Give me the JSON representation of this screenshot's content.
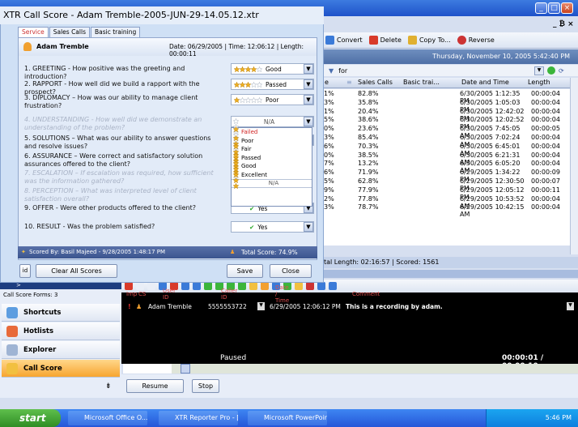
{
  "dialog": {
    "title": "XTR Call Score - Adam Tremble-2005-JUN-29-14.05.12.xtr",
    "tabs": [
      "Service",
      "Sales Calls",
      "Basic training"
    ],
    "agent_name": "Adam Tremble",
    "call_info": "Date: 06/29/2005 | Time: 12:06:12 | Length: 00:00:11",
    "questions": [
      {
        "text": "1. GREETING - How positive was the greeting and introduction?",
        "value": "Good",
        "stars": 4,
        "dim": false
      },
      {
        "text": "2. RAPPORT - How well did we build a rapport with the prospect?",
        "value": "Passed",
        "stars": 3,
        "dim": false
      },
      {
        "text": "3.  DIPLOMACY – How was our ability to manage client frustration?",
        "value": "Poor",
        "stars": 1,
        "dim": false
      },
      {
        "text": "4. UNDERSTANDING - How well did we demonstrate an understanding of the problem?",
        "value": "N/A",
        "stars": 0,
        "dim": true
      },
      {
        "text": "5. SOLUTIONS – What was our ability to answer questions and resolve issues?",
        "value": "",
        "stars": 0,
        "dim": false
      },
      {
        "text": "6. ASSURANCE – Were correct and satisfactory solution assurances offered to the client?",
        "value": "",
        "stars": 0,
        "dim": false
      },
      {
        "text": "7. ESCALATION – If escalation was required, how sufficient was the information gathered?",
        "value": "",
        "stars": 0,
        "dim": true
      },
      {
        "text": "8. PERCEPTION – What was interpreted level of client satisfaction overall?",
        "value": "",
        "stars": 0,
        "dim": true
      },
      {
        "text": "9. OFFER - Were other products offered to the client?",
        "value": "Yes",
        "stars": 0,
        "dim": false
      },
      {
        "text": "10. RESULT - Was the problem satisfied?",
        "value": "Yes",
        "stars": 0,
        "dim": false
      }
    ],
    "dropdown_options": [
      {
        "label": "Failed",
        "stars": 0,
        "color": "#d02020"
      },
      {
        "label": "Poor",
        "stars": 1,
        "color": "#000000"
      },
      {
        "label": "Fair",
        "stars": 2,
        "color": "#000000"
      },
      {
        "label": "Passed",
        "stars": 3,
        "color": "#000000"
      },
      {
        "label": "Good",
        "stars": 4,
        "color": "#000000"
      },
      {
        "label": "Excellent",
        "stars": 5,
        "color": "#000000"
      },
      {
        "label": "N/A",
        "stars": 0,
        "color": "#555555"
      }
    ],
    "scored_by": "Scored By: Basil Majeed - 9/28/2005 1:48:17 PM",
    "total_score": "Total Score: 74.9%",
    "clear_button": "Clear All Scores",
    "save_button": "Save",
    "close_button": "Close"
  },
  "main": {
    "toolbar": {
      "convert": "Convert",
      "delete": "Delete",
      "copy": "Copy To...",
      "reverse": "Reverse"
    },
    "date_banner": "Thursday, November 10, 2005 5:42:40 PM",
    "filter_label": "for",
    "columns": [
      "Sales Calls",
      "Basic trai...",
      "Date and Time",
      "Length"
    ],
    "rows": [
      {
        "a": "1%",
        "b": "82.8%",
        "d": "6/30/2005 1:12:35 PM",
        "e": "00:00:04"
      },
      {
        "a": "3%",
        "b": "35.8%",
        "d": "6/30/2005 1:05:03 PM",
        "e": "00:00:04"
      },
      {
        "a": "1%",
        "b": "20.4%",
        "d": "6/30/2005 12:42:02 PM",
        "e": "00:00:04"
      },
      {
        "a": "5%",
        "b": "38.6%",
        "d": "6/30/2005 12:02:52 PM",
        "e": "00:00:04"
      },
      {
        "a": "0%",
        "b": "23.6%",
        "d": "6/30/2005 7:45:05 AM",
        "e": "00:00:05"
      },
      {
        "a": "3%",
        "b": "85.4%",
        "d": "6/30/2005 7:02:24 AM",
        "e": "00:00:04"
      },
      {
        "a": "6%",
        "b": "70.3%",
        "d": "6/30/2005 6:45:01 AM",
        "e": "00:00:04"
      },
      {
        "a": "0%",
        "b": "38.5%",
        "d": "6/30/2005 6:21:31 AM",
        "e": "00:00:04"
      },
      {
        "a": "7%",
        "b": "13.2%",
        "d": "6/30/2005 6:05:20 AM",
        "e": "00:00:04"
      },
      {
        "a": "6%",
        "b": "71.9%",
        "d": "6/29/2005 1:34:22 PM",
        "e": "00:00:09"
      },
      {
        "a": "5%",
        "b": "62.8%",
        "d": "6/29/2005 12:30:50 PM",
        "e": "00:00:07"
      },
      {
        "a": "9%",
        "b": "77.9%",
        "d": "6/29/2005 12:05:12 PM",
        "e": "00:00:11"
      },
      {
        "a": "2%",
        "b": "77.8%",
        "d": "6/29/2005 10:53:52 AM",
        "e": "00:00:04"
      },
      {
        "a": "3%",
        "b": "78.7%",
        "d": "6/29/2005 10:42:15 AM",
        "e": "00:00:04"
      }
    ],
    "total_length": "tal Length: 02:16:57 | Scored: 1561"
  },
  "nav": {
    "forms_label": "Call Score Forms: 3",
    "items": [
      "Shortcuts",
      "Hotlists",
      "Explorer",
      "Call Score"
    ]
  },
  "player": {
    "headers": [
      "Imp",
      "CS",
      "User ID",
      "Caller ID",
      "Date / Time",
      "Comment"
    ],
    "user": "Adam Tremble",
    "caller": "5555553722",
    "datetime": "6/29/2005 12:06:12 PM",
    "comment": "This is a recording by adam.",
    "status": "Paused",
    "time": "00:00:01 / 00:00:10",
    "resume": "Resume",
    "stop": "Stop"
  },
  "taskbar": {
    "start": "start",
    "items": [
      "Microsoft Office O...",
      "XTR Reporter Pro - [S...",
      "Microsoft PowerPoint ..."
    ],
    "clock": "5:46 PM"
  },
  "colors": {
    "accent": "#f7a530",
    "title_blue": "#1e52c9",
    "star": "#f0b020"
  }
}
